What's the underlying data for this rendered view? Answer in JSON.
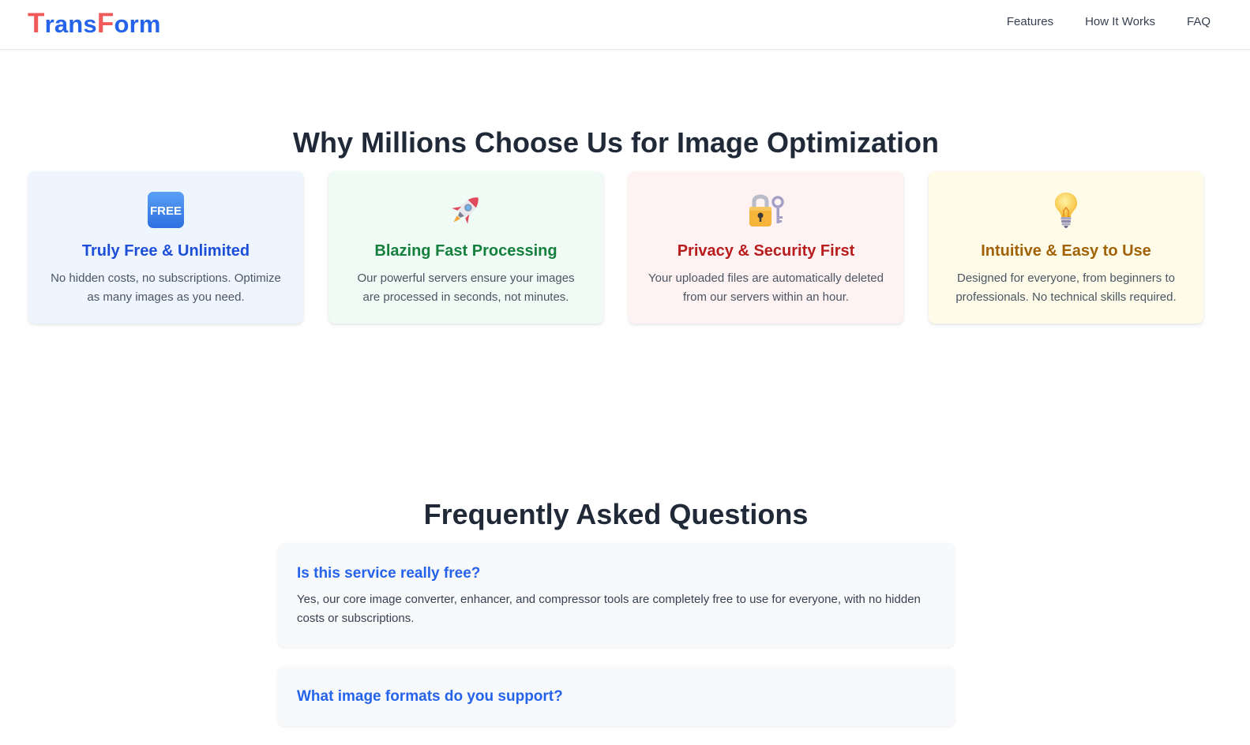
{
  "header": {
    "logo_first": "T",
    "logo_rest1": "rans",
    "logo_mid": "F",
    "logo_rest2": "orm",
    "nav": [
      {
        "label": "Features"
      },
      {
        "label": "How It Works"
      },
      {
        "label": "FAQ"
      }
    ]
  },
  "why": {
    "title": "Why Millions Choose Us for Image Optimization",
    "cards": [
      {
        "icon": "free-badge-icon",
        "title": "Truly Free & Unlimited",
        "text": "No hidden costs, no subscriptions. Optimize as many images as you need.",
        "bg": "#eff5ff",
        "title_color": "#1d4ed8"
      },
      {
        "icon": "rocket-icon",
        "title": "Blazing Fast Processing",
        "text": "Our powerful servers ensure your images are processed in seconds, not minutes.",
        "bg": "#effbf4",
        "title_color": "#15803d"
      },
      {
        "icon": "lock-key-icon",
        "title": "Privacy & Security First",
        "text": "Your uploaded files are automatically deleted from our servers within an hour.",
        "bg": "#fef2f2",
        "title_color": "#b91c1c"
      },
      {
        "icon": "lightbulb-icon",
        "title": "Intuitive & Easy to Use",
        "text": "Designed for everyone, from beginners to professionals. No technical skills required.",
        "bg": "#fefce8",
        "title_color": "#a16207"
      }
    ]
  },
  "faq": {
    "title": "Frequently Asked Questions",
    "items": [
      {
        "question": "Is this service really free?",
        "answer": "Yes, our core image converter, enhancer, and compressor tools are completely free to use for everyone, with no hidden costs or subscriptions."
      },
      {
        "question": "What image formats do you support?",
        "answer": ""
      }
    ]
  },
  "colors": {
    "logo_red": "#f05a5a",
    "logo_blue": "#2563eb",
    "faq_question": "#2563eb"
  }
}
